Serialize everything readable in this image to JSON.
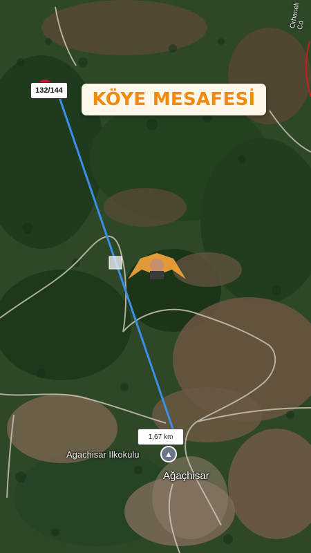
{
  "map": {
    "title": "KÖYE MESAFESİ",
    "parcel_label": "132/144",
    "distance_label": "1,67 km",
    "school_label": "Agachisar Ilkokulu",
    "village_label": "Ağaçhisar",
    "road_label": "Orhaneli Cd",
    "school_icon": "school-icon",
    "colors": {
      "accent": "#f08a12",
      "measure_line": "#3b8fe8",
      "badge_bg": "#fff7ea"
    }
  }
}
